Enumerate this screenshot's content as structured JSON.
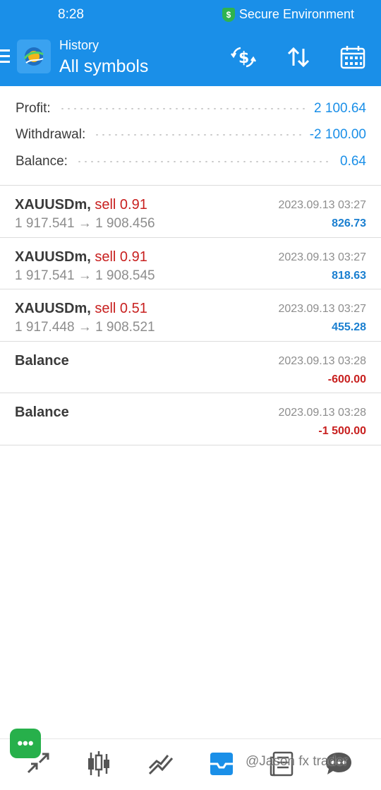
{
  "status_bar": {
    "time": "8:28",
    "secure_label": "Secure Environment"
  },
  "header": {
    "subtitle": "History",
    "title": "All symbols"
  },
  "summary": [
    {
      "label": "Profit:",
      "value": "2 100.64"
    },
    {
      "label": "Withdrawal:",
      "value": "-2 100.00"
    },
    {
      "label": "Balance:",
      "value": "0.64"
    }
  ],
  "deals": [
    {
      "symbol": "XAUUSDm,",
      "side": "sell 0.91",
      "prices": "1 917.541 → 1 908.456",
      "time": "2023.09.13 03:27",
      "profit": "826.73",
      "sign": "pos"
    },
    {
      "symbol": "XAUUSDm,",
      "side": "sell 0.91",
      "prices": "1 917.541 → 1 908.545",
      "time": "2023.09.13 03:27",
      "profit": "818.63",
      "sign": "pos"
    },
    {
      "symbol": "XAUUSDm,",
      "side": "sell 0.51",
      "prices": "1 917.448 → 1 908.521",
      "time": "2023.09.13 03:27",
      "profit": "455.28",
      "sign": "pos"
    },
    {
      "symbol": "Balance",
      "side": "",
      "prices": "",
      "time": "2023.09.13 03:28",
      "profit": "-600.00",
      "sign": "neg"
    },
    {
      "symbol": "Balance",
      "side": "",
      "prices": "",
      "time": "2023.09.13 03:28",
      "profit": "-1 500.00",
      "sign": "neg"
    }
  ],
  "fab_label": "•••",
  "bottom_nav": [
    "quotes-icon",
    "chart-icon",
    "trade-icon",
    "history-icon",
    "news-icon",
    "chat-icon"
  ],
  "watermark": "@Jason fx trader",
  "colors": {
    "header": "#1a8fe8",
    "positive": "#1a7fd0",
    "negative": "#c8201f",
    "fab": "#27b04b"
  }
}
